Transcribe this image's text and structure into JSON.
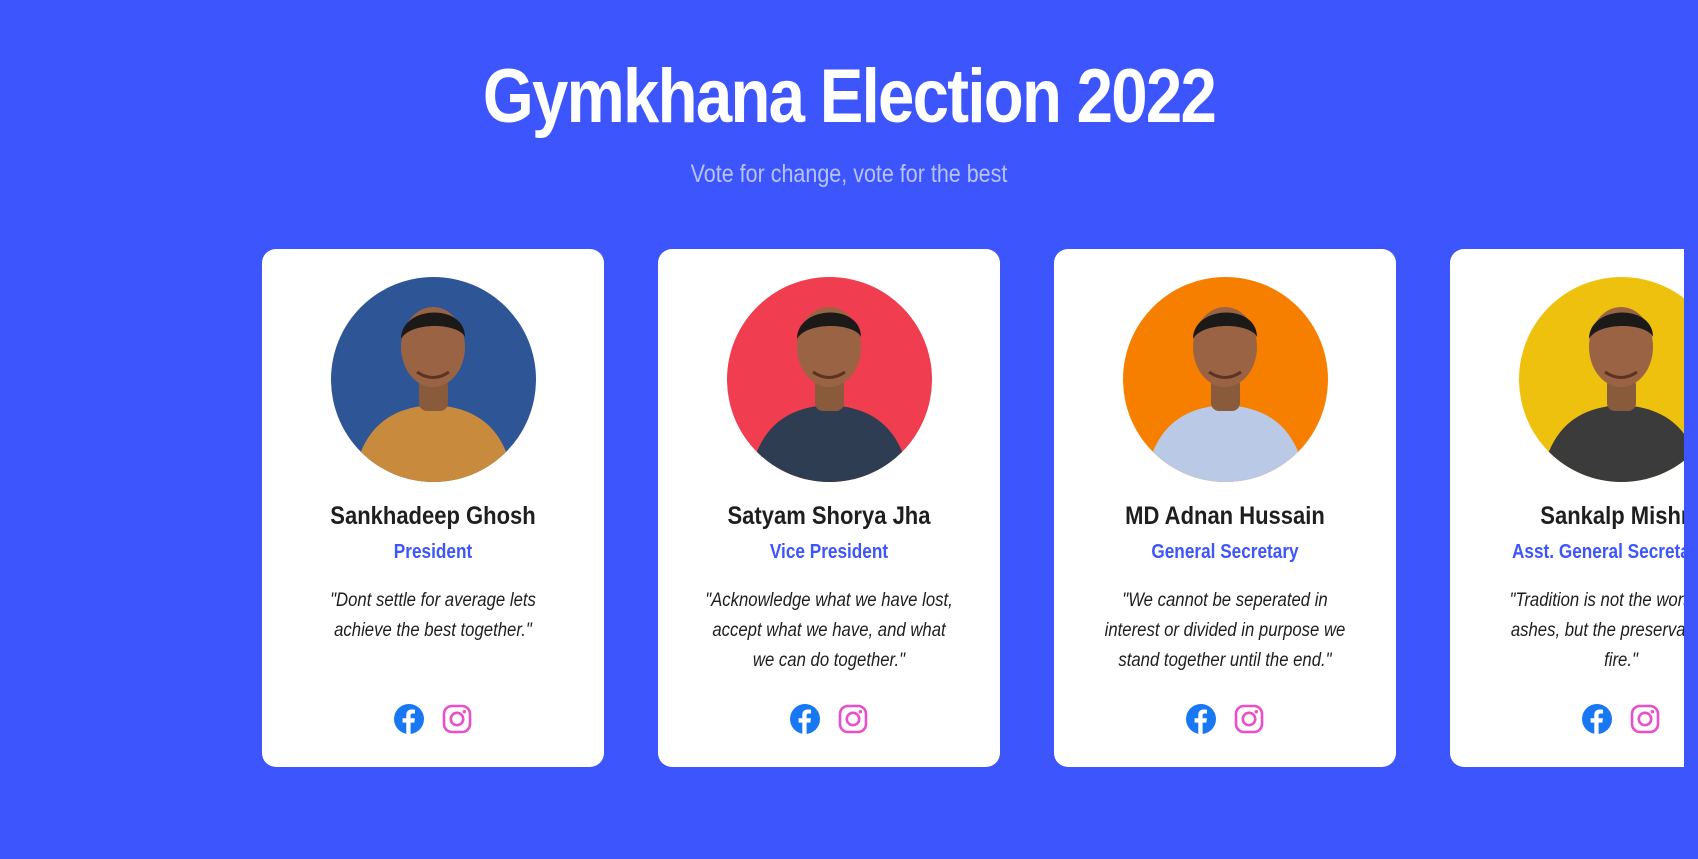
{
  "page": {
    "title": "Gymkhana Election 2022",
    "subtitle": "Vote for change, vote for the best"
  },
  "colors": {
    "background": "#3d55fc",
    "card": "#ffffff",
    "role_text": "#3d55fc",
    "facebook": "#1877f2",
    "instagram": "#e84fc8"
  },
  "candidates": [
    {
      "name": "Sankhadeep Ghosh",
      "role": "President",
      "quote": "\"Dont settle for average lets achieve the best together.\"",
      "photo_bg": "#2e5596",
      "shirt": "#c88a3c",
      "photo_alt": "Sankhadeep Ghosh photo"
    },
    {
      "name": "Satyam Shorya Jha",
      "role": "Vice President",
      "quote": "\"Acknowledge what we have lost, accept what we have, and what we can do together.\"",
      "photo_bg": "#f03d50",
      "shirt": "#2e3d52",
      "photo_alt": "Satyam Shorya Jha photo"
    },
    {
      "name": "MD Adnan Hussain",
      "role": "General Secretary",
      "quote": "\"We cannot be seperated in interest or divided in purpose we stand together until the end.\"",
      "photo_bg": "#f77f00",
      "shirt": "#b9c9e6",
      "photo_alt": "MD Adnan Hussain photo"
    },
    {
      "name": "Sankalp Mishra",
      "role": "Asst. General Secretary (G",
      "quote": "\"Tradition is not the worship of ashes, but the preservation of fire.\"",
      "photo_bg": "#efc10f",
      "shirt": "#3b3b3b",
      "photo_alt": "Sankalp Mishra photo"
    }
  ],
  "icons": {
    "facebook": "facebook-icon",
    "instagram": "instagram-icon"
  }
}
